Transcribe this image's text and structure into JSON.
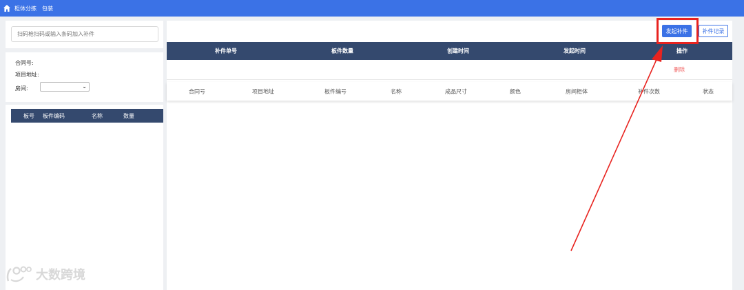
{
  "topbar": {
    "home_icon": "home-icon",
    "nav_items": [
      "柜体分拣",
      "包装"
    ],
    "bg_color": "#3b72e6"
  },
  "search": {
    "placeholder": "扫码枪扫码或输入条码加入补件"
  },
  "info": {
    "contract_label": "合同号:",
    "address_label": "项目地址:",
    "room_label": "房间:",
    "room_value": ""
  },
  "left_list": {
    "columns": [
      "板号",
      "板件编码",
      "名称",
      "数量"
    ]
  },
  "main": {
    "start_button": "发起补件",
    "record_button": "补件记录",
    "columns": [
      "补件单号",
      "板件数量",
      "创建时间",
      "发起时间",
      "操作"
    ],
    "rows": [
      {
        "delete_label": "删除"
      }
    ],
    "sub_columns": [
      "合同号",
      "项目地址",
      "板件编号",
      "名称",
      "成品尺寸",
      "颜色",
      "房间柜体",
      "补件次数",
      "状态"
    ]
  },
  "watermark": {
    "text": "大数跨境"
  },
  "colors": {
    "header_dark": "#34496e",
    "accent": "#3b72e6",
    "annotation": "#e8231f",
    "danger_text": "#f05a5a"
  }
}
